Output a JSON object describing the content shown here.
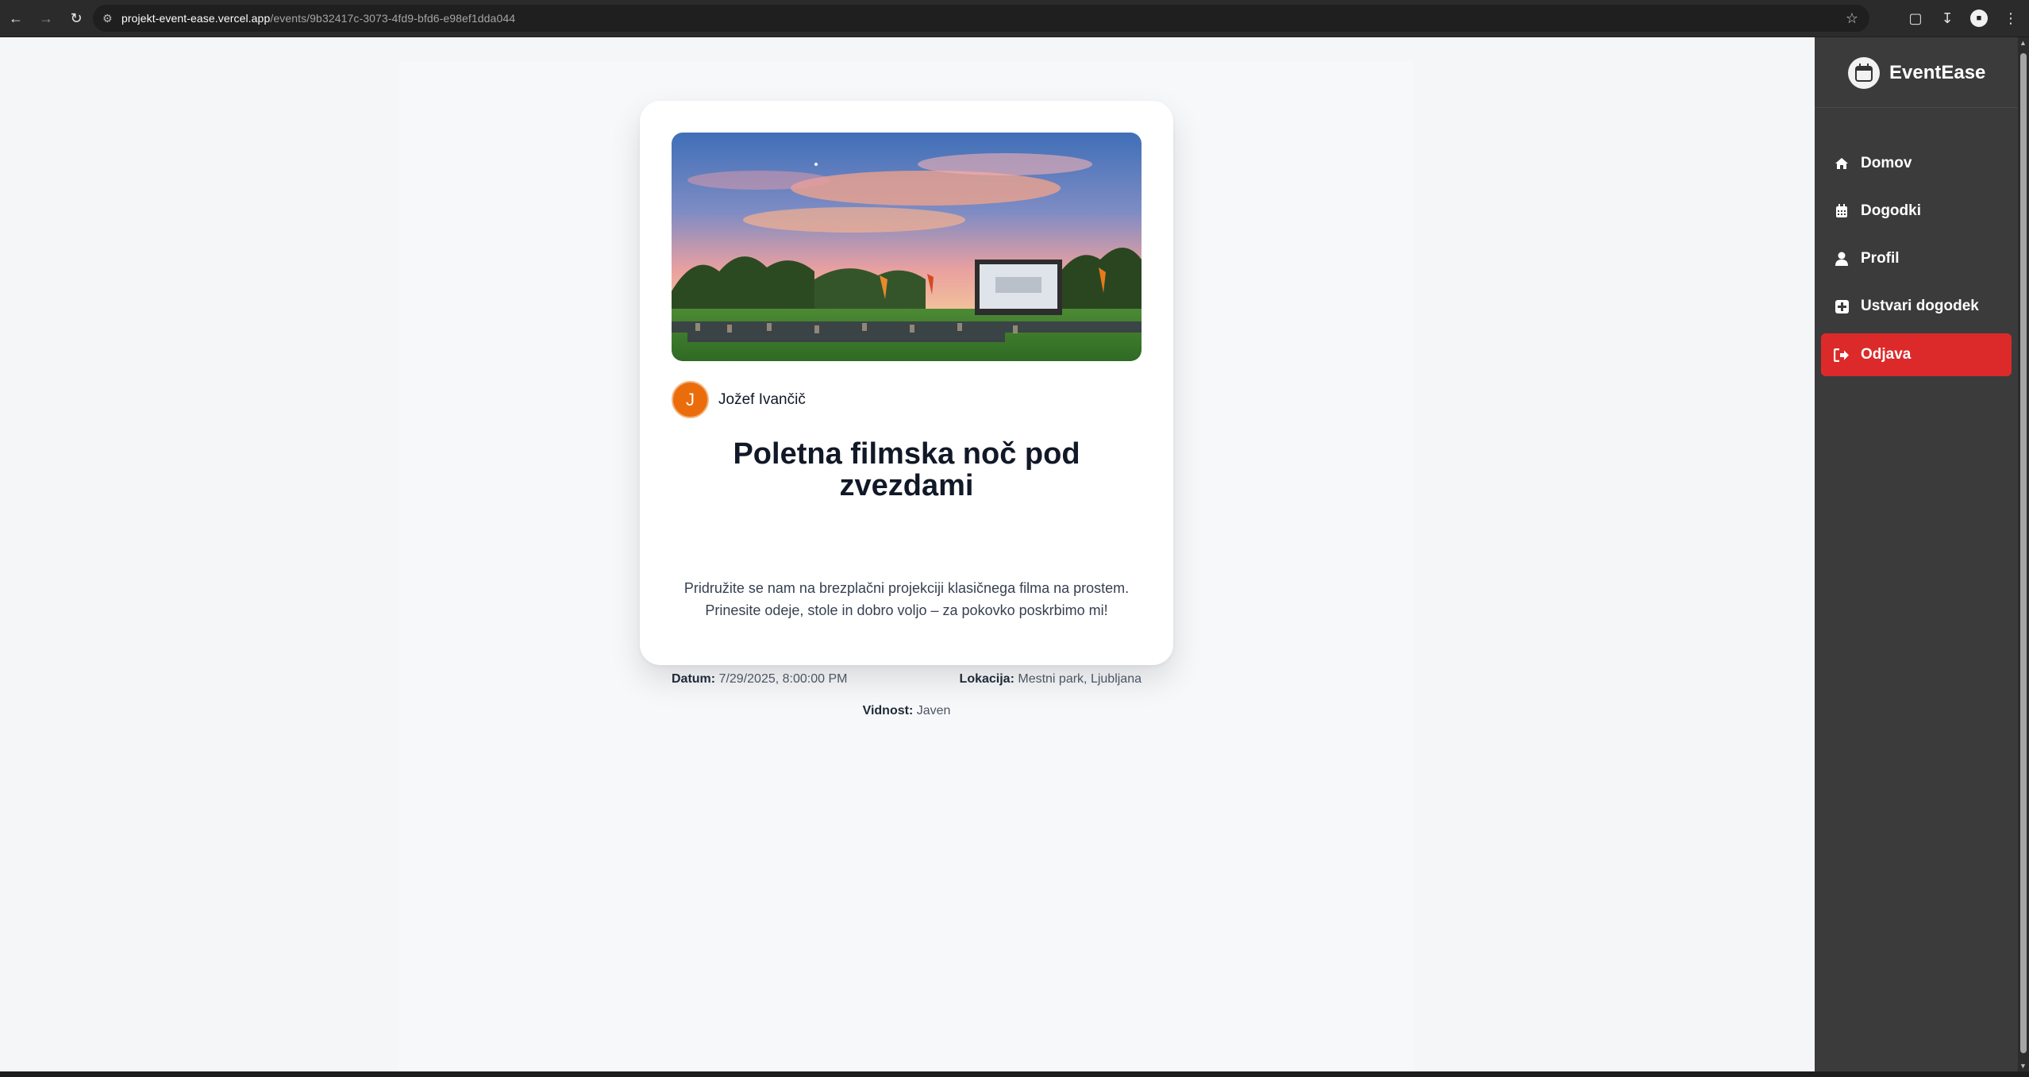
{
  "browser": {
    "url_host": "projekt-event-ease.vercel.app",
    "url_path": "/events/9b32417c-3073-4fd9-bfd6-e98ef1dda044"
  },
  "event": {
    "author_initial": "J",
    "author_name": "Jožef Ivančič",
    "title": "Poletna filmska noč pod zvezdami",
    "description": "Pridružite se nam na brezplačni projekciji klasičnega filma na prostem. Prinesite odeje, stole in dobro voljo – za pokovko poskrbimo mi!",
    "date_label": "Datum:",
    "date_value": "7/29/2025, 8:00:00 PM",
    "location_label": "Lokacija:",
    "location_value": "Mestni park, Ljubljana",
    "visibility_label": "Vidnost:",
    "visibility_value": "Javen"
  },
  "sidebar": {
    "brand": "EventEase",
    "items": [
      {
        "label": "Domov",
        "icon": "home-icon"
      },
      {
        "label": "Dogodki",
        "icon": "calendar-icon"
      },
      {
        "label": "Profil",
        "icon": "user-icon"
      },
      {
        "label": "Ustvari dogodek",
        "icon": "plus-square-icon"
      },
      {
        "label": "Odjava",
        "icon": "sign-out-icon"
      }
    ]
  },
  "colors": {
    "logout_bg": "#dc2a2a",
    "avatar_bg": "#ea6c0a",
    "sidebar_bg": "#3b3b3b"
  }
}
